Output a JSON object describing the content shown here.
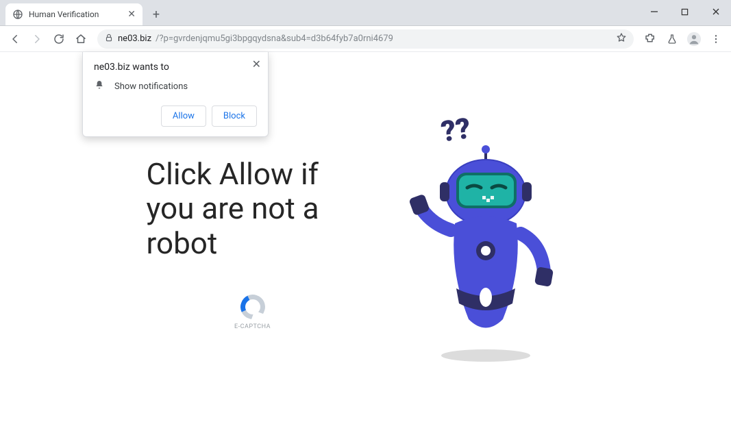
{
  "window": {
    "minimize_tooltip": "Minimize",
    "maximize_tooltip": "Maximize",
    "close_tooltip": "Close"
  },
  "tab": {
    "title": "Human Verification"
  },
  "toolbar": {
    "url_host": "ne03.biz",
    "url_path": "/?p=gvrdenjqmu5gi3bpgqydsna&sub4=d3b64fyb7a0rni4679"
  },
  "permission": {
    "title": "ne03.biz wants to",
    "line1": "Show notifications",
    "allow": "Allow",
    "block": "Block"
  },
  "page": {
    "headline": "Click Allow if you are not a robot",
    "captcha_label": "E-CAPTCHA",
    "qmarks": "??"
  },
  "colors": {
    "robot_primary": "#4a4fd8",
    "robot_dark": "#2f2f66",
    "robot_visor": "#1fb3a6",
    "accent_blue": "#1a73e8"
  }
}
